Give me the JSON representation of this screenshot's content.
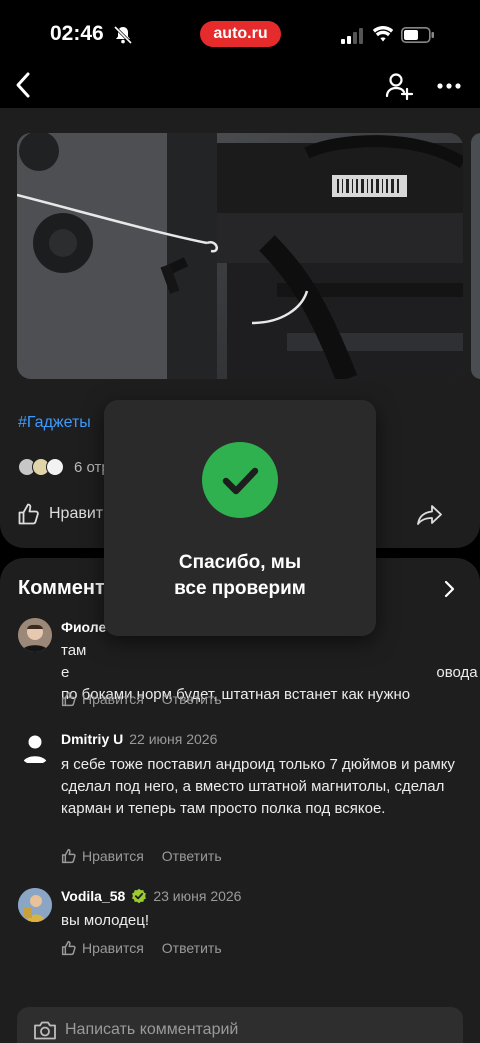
{
  "status_bar": {
    "time": "02:46",
    "brand": "auto.ru"
  },
  "post": {
    "hashtag": "#Гаджеты",
    "reposts_text": "6 отр",
    "like_label": "Нравит"
  },
  "comments": {
    "title": "Коммент",
    "items": [
      {
        "author": "Фиоле",
        "date": "",
        "verified": false,
        "text": "там е                                            овода по боками норм будет, штатная встанет как нужно",
        "like": "Нравится",
        "reply": "Ответить"
      },
      {
        "author": "Dmitriy U",
        "date": "22 июня 2026",
        "verified": false,
        "text": "я себе тоже поставил андроид только 7 дюймов и рамку сделал под него, а вместо штатной магнитолы, сделал карман и теперь там просто полка под всякое.",
        "like": "Нравится",
        "reply": "Ответить"
      },
      {
        "author": "Vodila_58",
        "date": "23 июня 2026",
        "verified": true,
        "text": "вы молодец!",
        "like": "Нравится",
        "reply": "Ответить"
      }
    ]
  },
  "input": {
    "placeholder": "Написать комментарий"
  },
  "toast": {
    "message": "Спасибо, мы\nвсе проверим"
  },
  "colors": {
    "accent_blue": "#3d9bff",
    "brand_red": "#e52b2b",
    "success_green": "#2fb150",
    "card_bg": "#1e1e1e"
  }
}
